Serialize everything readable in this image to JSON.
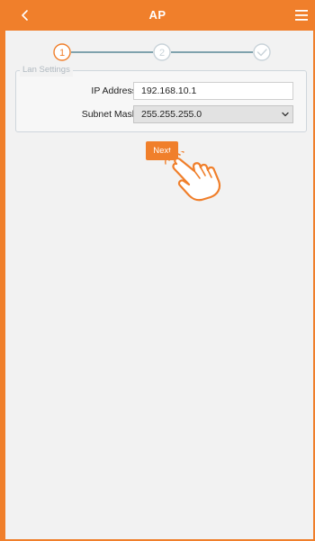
{
  "header": {
    "title": "AP",
    "back_icon": "chevron-left-icon",
    "menu_icon": "hamburger-menu-icon"
  },
  "stepper": {
    "steps": [
      {
        "label": "1",
        "state": "active"
      },
      {
        "label": "2",
        "state": "pending"
      },
      {
        "label": "",
        "icon": "check-icon",
        "state": "pending"
      }
    ]
  },
  "lan_settings": {
    "legend": "Lan Settings",
    "ip_label": "IP Address",
    "ip_value": "192.168.10.1",
    "mask_label": "Subnet Mask",
    "mask_value": "255.255.255.0"
  },
  "actions": {
    "next_label": "Next",
    "pointer_icon": "tap-hand-icon"
  },
  "colors": {
    "accent": "#f07f2b",
    "step_inactive": "#c9d3d9",
    "step_line": "#7fa2ad"
  }
}
